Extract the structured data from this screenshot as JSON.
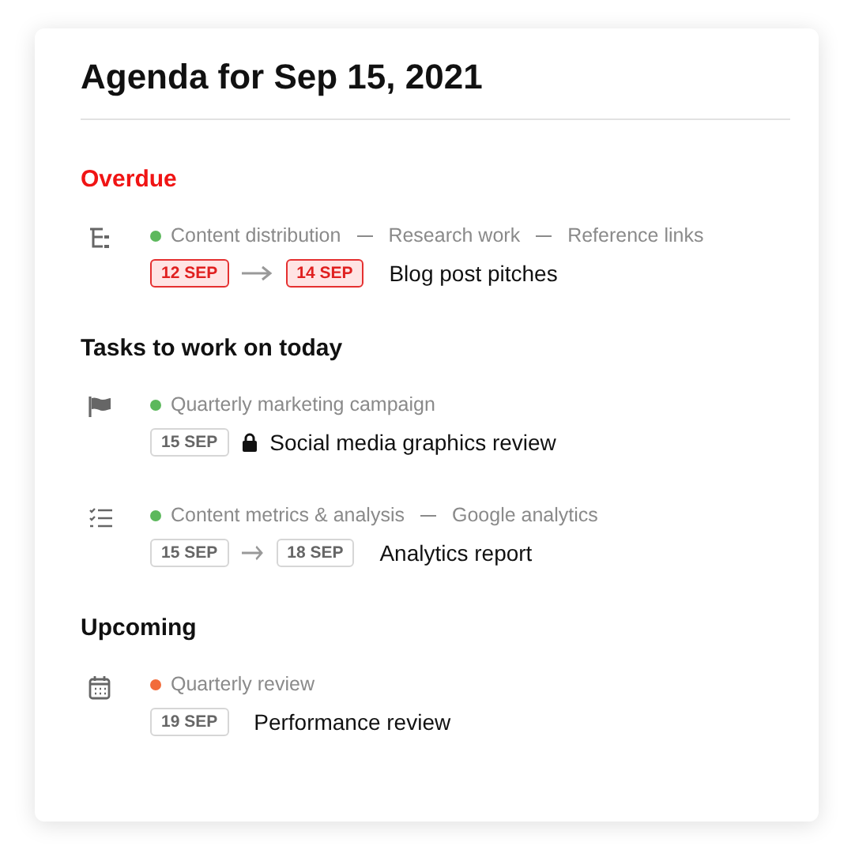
{
  "title": "Agenda for Sep 15, 2021",
  "sections": [
    {
      "heading": "Overdue",
      "kind": "overdue",
      "tasks": [
        {
          "kind": "subtasks",
          "color": "#5cb85c",
          "path": [
            "Content distribution",
            "Research work",
            "Reference links"
          ],
          "dates": [
            "12 SEP",
            "14 SEP"
          ],
          "locked": false,
          "title": "Blog post pitches"
        }
      ]
    },
    {
      "heading": "Tasks to work on today",
      "kind": "normal",
      "tasks": [
        {
          "kind": "flag",
          "color": "#5cb85c",
          "path": [
            "Quarterly marketing campaign"
          ],
          "dates": [
            "15 SEP"
          ],
          "locked": true,
          "title": "Social media graphics review"
        },
        {
          "kind": "checklist",
          "color": "#5cb85c",
          "path": [
            "Content metrics & analysis",
            "Google analytics"
          ],
          "dates": [
            "15 SEP",
            "18 SEP"
          ],
          "locked": false,
          "title": "Analytics report"
        }
      ]
    },
    {
      "heading": "Upcoming",
      "kind": "normal",
      "tasks": [
        {
          "kind": "calendar",
          "color": "#f26b3a",
          "path": [
            "Quarterly review"
          ],
          "dates": [
            "19 SEP"
          ],
          "locked": false,
          "title": "Performance review"
        }
      ]
    }
  ]
}
